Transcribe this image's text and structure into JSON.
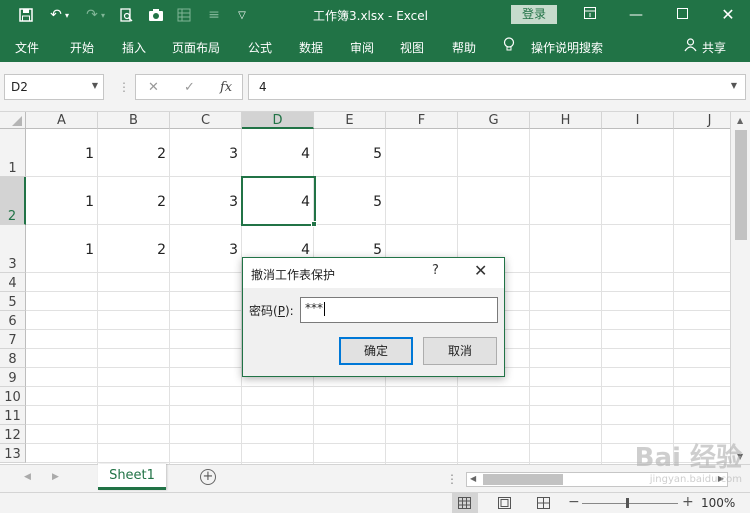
{
  "title_bar": {
    "title": "工作簿3.xlsx  -  Excel",
    "login_label": "登录",
    "qa_icons": [
      "save-icon",
      "undo-icon",
      "redo-icon",
      "print-preview-icon",
      "camera-icon",
      "table-icon",
      "align-icon",
      "customize-qat-icon"
    ]
  },
  "ribbon": {
    "tabs": [
      "文件",
      "开始",
      "插入",
      "页面布局",
      "公式",
      "数据",
      "审阅",
      "视图",
      "帮助"
    ],
    "tell_me": "操作说明搜索",
    "share": "共享"
  },
  "formula_bar": {
    "name_box": "D2",
    "fx_label": "fx",
    "content": "4"
  },
  "grid": {
    "columns": [
      "A",
      "B",
      "C",
      "D",
      "E",
      "F",
      "G",
      "H",
      "I",
      "J"
    ],
    "rows": [
      "1",
      "2",
      "3",
      "4",
      "5",
      "6",
      "7",
      "8",
      "9",
      "10",
      "11",
      "12",
      "13"
    ],
    "cells": [
      [
        "1",
        "2",
        "3",
        "4",
        "5"
      ],
      [
        "1",
        "2",
        "3",
        "4",
        "5"
      ],
      [
        "1",
        "2",
        "3",
        "4",
        "5"
      ]
    ],
    "selected_cell": "D2"
  },
  "sheets": {
    "tabs": [
      "Sheet1"
    ]
  },
  "status": {
    "zoom": "100%"
  },
  "dialog": {
    "title": "撤消工作表保护",
    "help": "?",
    "password_label_prefix": "密码(",
    "password_label_key": "P",
    "password_label_suffix": "):",
    "password_value": "***",
    "ok_label": "确定",
    "cancel_label": "取消"
  },
  "watermark": {
    "text": "Bai 经验",
    "sub": "jingyan.baidu.com"
  }
}
